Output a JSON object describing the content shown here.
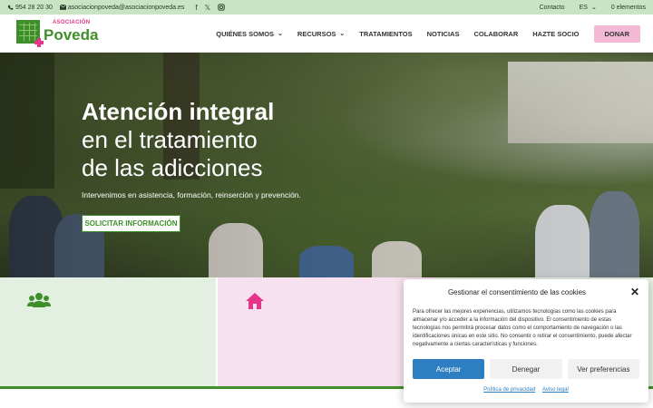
{
  "topbar": {
    "phone": "954 28 20 30",
    "email": "asociacionpoveda@asociacionpoveda.es",
    "social": [
      "facebook-icon",
      "x-icon",
      "instagram-icon"
    ],
    "contact": "Contacto",
    "language": "ES",
    "cart": "0 elementos"
  },
  "logo": {
    "small": "ASOCIACIÓN",
    "big": "Poveda"
  },
  "nav": {
    "items": [
      {
        "label": "QUIÉNES SOMOS",
        "has_dropdown": true
      },
      {
        "label": "RECURSOS",
        "has_dropdown": true
      },
      {
        "label": "TRATAMIENTOS",
        "has_dropdown": false
      },
      {
        "label": "NOTICIAS",
        "has_dropdown": false
      },
      {
        "label": "COLABORAR",
        "has_dropdown": false
      },
      {
        "label": "HAZTE SOCIO",
        "has_dropdown": false
      }
    ],
    "donate": "DONAR"
  },
  "hero": {
    "line1": "Atención integral",
    "line2": "en el tratamiento",
    "line3": "de las adicciones",
    "subtitle": "Intervenimos en asistencia, formación, reinserción y prevención.",
    "cta": "SOLICITAR INFORMACIÓN"
  },
  "cards": [
    {
      "icon": "users-icon",
      "color": "#3e8f2a"
    },
    {
      "icon": "home-icon",
      "color": "#e6348a"
    }
  ],
  "cookie": {
    "title": "Gestionar el consentimiento de las cookies",
    "text": "Para ofrecer las mejores experiencias, utilizamos tecnologías como las cookies para almacenar y/o acceder a la información del dispositivo. El consentimiento de estas tecnologías nos permitirá procesar datos como el comportamiento de navegación o las identificaciones únicas en este sitio. No consentir o retirar el consentimiento, puede afectar negativamente a ciertas características y funciones.",
    "accept": "Aceptar",
    "deny": "Denegar",
    "preferences": "Ver preferencias",
    "privacy_link": "Política de privacidad",
    "legal_link": "Aviso legal"
  },
  "colors": {
    "brand_green": "#3e8f2a",
    "brand_pink": "#e6348a",
    "accept_blue": "#2d7fc1"
  }
}
